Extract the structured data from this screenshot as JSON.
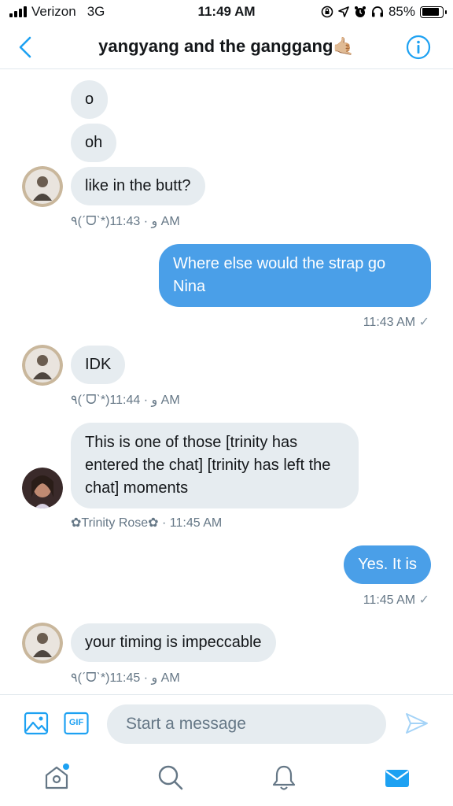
{
  "status_bar": {
    "carrier": "Verizon",
    "network": "3G",
    "time": "11:49 AM",
    "battery": "85%",
    "battery_level": 0.85,
    "icons": [
      "screen-rotation-lock-icon",
      "location-icon",
      "alarm-icon",
      "headphones-icon"
    ]
  },
  "header": {
    "title": "yangyang and the ganggang🤙🏼",
    "back_icon": "chevron-left-icon",
    "info_icon": "info-icon"
  },
  "messages": [
    {
      "direction": "in",
      "text": "o"
    },
    {
      "direction": "in",
      "text": "oh"
    },
    {
      "direction": "in",
      "text": "like in the butt?",
      "sender": "٩(ˊᗜˋ*)و",
      "time": "11:43 AM"
    },
    {
      "direction": "out",
      "text": "Where else would the strap go Nina",
      "time": "11:43 AM"
    },
    {
      "direction": "in",
      "text": "IDK",
      "sender": "٩(ˊᗜˋ*)و",
      "time": "11:44 AM"
    },
    {
      "direction": "in",
      "text": "This is one of those [trinity has entered the chat] [trinity has left the chat] moments",
      "sender": "✿Trinity Rose✿",
      "time": "11:45 AM"
    },
    {
      "direction": "out",
      "text": "Yes. It is",
      "time": "11:45 AM"
    },
    {
      "direction": "in",
      "text": "your timing is impeccable",
      "sender": "٩(ˊᗜˋ*)و",
      "time": "11:45 AM"
    }
  ],
  "separator": " · ",
  "read_check": "✓",
  "composer": {
    "placeholder": "Start a message",
    "image_icon": "image-icon",
    "gif_label": "GIF",
    "send_icon": "send-icon"
  },
  "tab_bar": [
    "home-icon",
    "search-icon",
    "notifications-icon",
    "messages-icon"
  ],
  "colors": {
    "accent": "#1da1f2",
    "outgoing_bubble": "#4a9fe8",
    "incoming_bubble": "#e6ecf0"
  }
}
